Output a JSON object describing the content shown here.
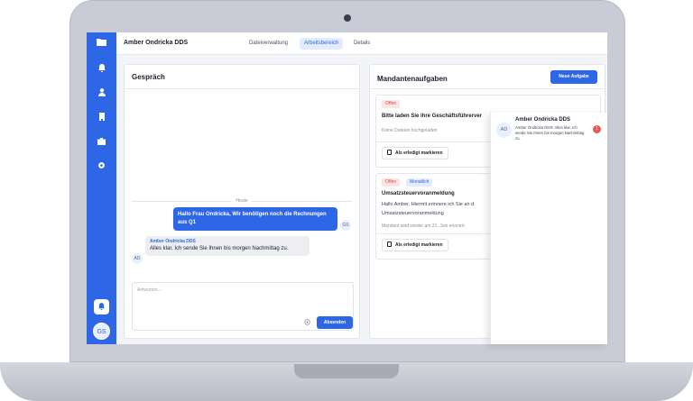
{
  "header": {
    "client_name": "Amber Ondricka DDS",
    "tabs": [
      {
        "label": "Dateiverwaltung",
        "active": false
      },
      {
        "label": "Arbeitsbereich",
        "active": true
      },
      {
        "label": "Details",
        "active": false
      }
    ]
  },
  "sidebar": {
    "items": [
      {
        "icon": "folder-icon"
      },
      {
        "icon": "bell-icon"
      },
      {
        "icon": "user-icon"
      },
      {
        "icon": "building-icon"
      },
      {
        "icon": "briefcase-icon"
      },
      {
        "icon": "gear-icon"
      }
    ],
    "bottom_icon": "bell-icon",
    "user_initials": "GS"
  },
  "chat": {
    "title": "Gespräch",
    "divider": "Heute",
    "messages": [
      {
        "direction": "out",
        "text": "Hallo Frau Ondricka, Wir benötigen noch die Rechnungen aus Q1",
        "avatar": "GS"
      },
      {
        "direction": "in",
        "sender": "Amber Ondricka DDS",
        "text": "Alles klar, Ich sende Sie Ihnen bis morgen Nachmittag zu.",
        "avatar": "AD"
      }
    ],
    "composer_placeholder": "Antworten...",
    "send_label": "Absenden"
  },
  "tasks": {
    "title": "Mandantenaufgaben",
    "new_label": "Neue Aufgabe",
    "items": [
      {
        "badges": [
          "Offen"
        ],
        "title": "Bitte laden Sie ihre Geschäftsführerver",
        "meta": "Keine Dateien hochgeladen",
        "action": "Als erledigt markieren"
      },
      {
        "badges": [
          "Offen",
          "Monatlich"
        ],
        "title": "Umsatzsteuervoranmeldung",
        "line1": "Hallo Amber, Hiermit erinnere ich Sie an d",
        "line2": "Umsatzsteuervoranmeldung",
        "meta": "Mandant wird wieder am 21. Juni erinnert",
        "action": "Als erledigt markieren"
      }
    ]
  },
  "notification": {
    "avatar": "AD",
    "name": "Amber Ondricka DDS",
    "message": "Amber Ondricka DDS: Alles klar, Ich sende Sie Ihnen bis morgen Nachmittag zu.",
    "count": "1"
  },
  "colors": {
    "accent": "#2d67e6",
    "danger": "#e05a5a"
  }
}
